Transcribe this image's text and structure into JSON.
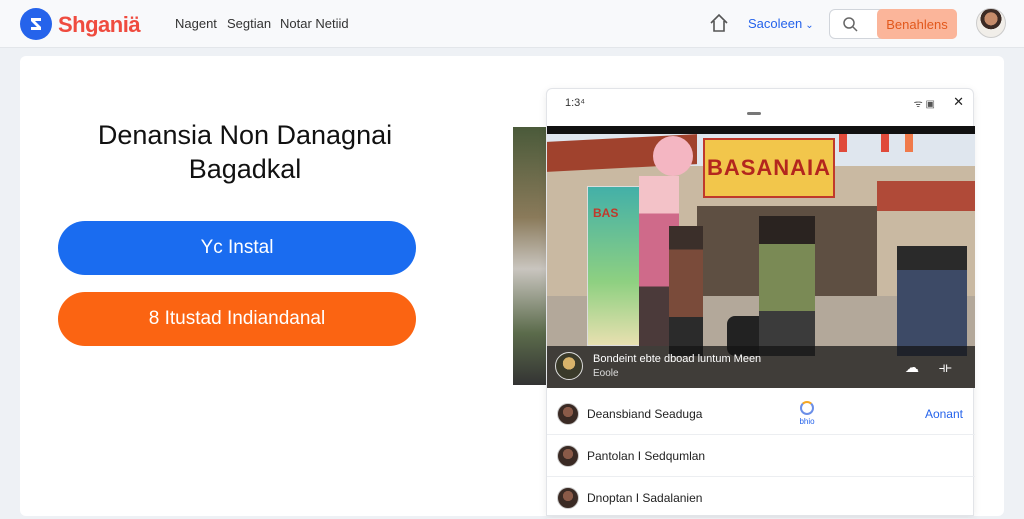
{
  "brand": {
    "name": "Shganiä"
  },
  "nav": {
    "items": [
      "Nagent",
      "Segtian",
      "Notar Netiid"
    ]
  },
  "header": {
    "dropdown_label": "Sacoleen",
    "cta_label": "Benahlens"
  },
  "hero": {
    "title_line1": "Denansia Non Danagnai",
    "title_line2": "Bagadkal",
    "primary_button": "Yc Instal",
    "secondary_button": "8 Itustad Indiandanal"
  },
  "device": {
    "status_time": "1:3⁴",
    "status_icons": "ᯤ ▣",
    "close_glyph": "✕",
    "video": {
      "banner_text": "BASANAIA",
      "poster_text": "BAS",
      "overlay_title": "Bondeint ebte dboad luntum Meen",
      "overlay_subtitle": "Eoole"
    },
    "list": [
      {
        "name": "Deansbiand Seaduga",
        "mid_label": "bhio",
        "right_label": "Aonant"
      },
      {
        "name": "Pantolan I Sedqumlan",
        "mid_label": "",
        "right_label": ""
      },
      {
        "name": "Dnoptan I Sadalanien",
        "mid_label": "",
        "right_label": ""
      }
    ]
  },
  "colors": {
    "primary": "#1a6cf0",
    "accent": "#fb6412",
    "brand": "#ef4b3f"
  }
}
